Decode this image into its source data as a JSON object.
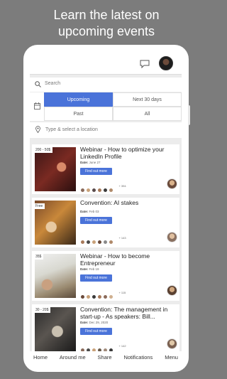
{
  "headline": {
    "line1": "Learn the latest on",
    "line2": "upcoming events"
  },
  "search": {
    "placeholder": "Search"
  },
  "filters": {
    "upcoming": "Upcoming",
    "next30": "Next 30 days",
    "past": "Past",
    "all": "All",
    "active": "Upcoming"
  },
  "location": {
    "placeholder": "Type & select a location"
  },
  "events": [
    {
      "price": "200 - 50$",
      "title": "Webinar - How to optimize your LinkedIn Profile",
      "date_label": "Date:",
      "date": "June 27",
      "button": "Find out more",
      "count": "+ 394"
    },
    {
      "price": "Free",
      "title": "Convention: AI stakes",
      "date_label": "Date:",
      "date": "Feb 03",
      "button": "Find out more",
      "count": "+ 143"
    },
    {
      "price": "35$",
      "title": "Webinar - How to become Entrepreneur",
      "date_label": "Date:",
      "date": "Feb 19",
      "button": "Find out more",
      "count": "+ 115"
    },
    {
      "price": "30 - 20$",
      "title": "Convention: The management in start-up - As speakers: Bill...",
      "date_label": "Date:",
      "date": "Dec 29, 2020",
      "button": "Find out more",
      "count": "+ 142"
    }
  ],
  "nav": {
    "home": "Home",
    "around": "Around me",
    "share": "Share",
    "notifications": "Notifications",
    "menu": "Menu"
  },
  "colors": {
    "accent": "#4a73d9",
    "background": "#7c7c7c"
  },
  "icons": [
    "chat-icon",
    "avatar",
    "search-icon",
    "calendar-icon",
    "location-pin-icon"
  ]
}
